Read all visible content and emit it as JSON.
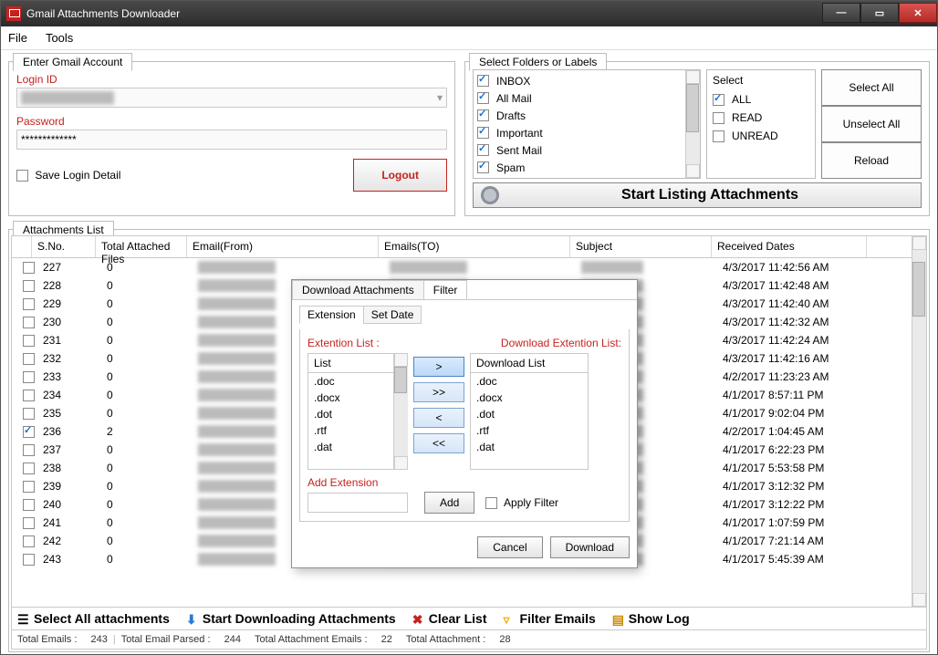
{
  "window": {
    "title": "Gmail Attachments Downloader"
  },
  "menu": {
    "file": "File",
    "tools": "Tools"
  },
  "login": {
    "tab": "Enter Gmail Account",
    "loginIdLabel": "Login ID",
    "loginIdValue": "",
    "passwordLabel": "Password",
    "passwordValue": "*************",
    "saveLogin": "Save Login Detail",
    "logout": "Logout"
  },
  "folders": {
    "tab": "Select Folders or Labels",
    "items": [
      "INBOX",
      "All Mail",
      "Drafts",
      "Important",
      "Sent Mail",
      "Spam"
    ],
    "selectHeader": "Select",
    "selectItems": [
      "ALL",
      "READ",
      "UNREAD"
    ],
    "selectAll": "Select All",
    "unselectAll": "Unselect All",
    "reload": "Reload",
    "startListing": "Start Listing Attachments"
  },
  "attTab": "Attachments List",
  "grid": {
    "headers": {
      "sno": "S.No.",
      "cnt": "Total Attached Files",
      "from": "Email(From)",
      "to": "Emails(TO)",
      "subj": "Subject",
      "date": "Received Dates"
    },
    "rows": [
      {
        "sno": "227",
        "cnt": "0",
        "date": "4/3/2017 11:42:56 AM",
        "checked": false,
        "flag": false
      },
      {
        "sno": "228",
        "cnt": "0",
        "date": "4/3/2017 11:42:48 AM",
        "checked": false,
        "flag": false
      },
      {
        "sno": "229",
        "cnt": "0",
        "date": "4/3/2017 11:42:40 AM",
        "checked": false,
        "flag": false
      },
      {
        "sno": "230",
        "cnt": "0",
        "date": "4/3/2017 11:42:32 AM",
        "checked": false,
        "flag": false
      },
      {
        "sno": "231",
        "cnt": "0",
        "date": "4/3/2017 11:42:24 AM",
        "checked": false,
        "flag": false
      },
      {
        "sno": "232",
        "cnt": "0",
        "date": "4/3/2017 11:42:16 AM",
        "checked": false,
        "flag": false
      },
      {
        "sno": "233",
        "cnt": "0",
        "date": "4/2/2017 11:23:23 AM",
        "checked": false,
        "flag": false
      },
      {
        "sno": "234",
        "cnt": "0",
        "date": "4/1/2017 8:57:11 PM",
        "checked": false,
        "flag": false
      },
      {
        "sno": "235",
        "cnt": "0",
        "date": "4/1/2017 9:02:04 PM",
        "checked": false,
        "flag": false
      },
      {
        "sno": "236",
        "cnt": "2",
        "date": "4/2/2017 1:04:45 AM",
        "checked": true,
        "flag": true
      },
      {
        "sno": "237",
        "cnt": "0",
        "date": "4/1/2017 6:22:23 PM",
        "checked": false,
        "flag": false
      },
      {
        "sno": "238",
        "cnt": "0",
        "date": "4/1/2017 5:53:58 PM",
        "checked": false,
        "flag": false
      },
      {
        "sno": "239",
        "cnt": "0",
        "date": "4/1/2017 3:12:32 PM",
        "checked": false,
        "flag": false
      },
      {
        "sno": "240",
        "cnt": "0",
        "date": "4/1/2017 3:12:22 PM",
        "checked": false,
        "flag": false
      },
      {
        "sno": "241",
        "cnt": "0",
        "date": "4/1/2017 1:07:59 PM",
        "checked": false,
        "flag": false
      },
      {
        "sno": "242",
        "cnt": "0",
        "date": "4/1/2017 7:21:14 AM",
        "checked": false,
        "flag": false
      },
      {
        "sno": "243",
        "cnt": "0",
        "date": "4/1/2017 5:45:39 AM",
        "checked": false,
        "flag": false
      }
    ]
  },
  "toolbar": {
    "selectAll": "Select All attachments",
    "startDownload": "Start Downloading Attachments",
    "clearList": "Clear List",
    "filterEmails": "Filter Emails",
    "showLog": "Show Log"
  },
  "status": {
    "totalEmailsLabel": "Total Emails :",
    "totalEmailsValue": "243",
    "totalEmailParsedLabel": "Total Email Parsed :",
    "totalEmailParsedValue": "244",
    "totalAttachmentEmailsLabel": "Total Attachment Emails :",
    "totalAttachmentEmailsValue": "22",
    "totalAttachmentLabel": "Total Attachment :",
    "totalAttachmentValue": "28"
  },
  "dialog": {
    "tab1": "Download Attachments",
    "tab2": "Filter",
    "subtab1": "Extension",
    "subtab2": "Set Date",
    "extListLabel": "Extention List :",
    "dlListLabel": "Download Extention List:",
    "listHeader": "List",
    "dlListHeader": "Download List",
    "extItems": [
      ".doc",
      ".docx",
      ".dot",
      ".rtf",
      ".dat"
    ],
    "dlItems": [
      ".doc",
      ".docx",
      ".dot",
      ".rtf",
      ".dat"
    ],
    "arrows": {
      "r": ">",
      "rr": ">>",
      "l": "<",
      "ll": "<<"
    },
    "addExtLabel": "Add Extension",
    "addBtn": "Add",
    "applyFilter": "Apply Filter",
    "cancel": "Cancel",
    "download": "Download"
  }
}
